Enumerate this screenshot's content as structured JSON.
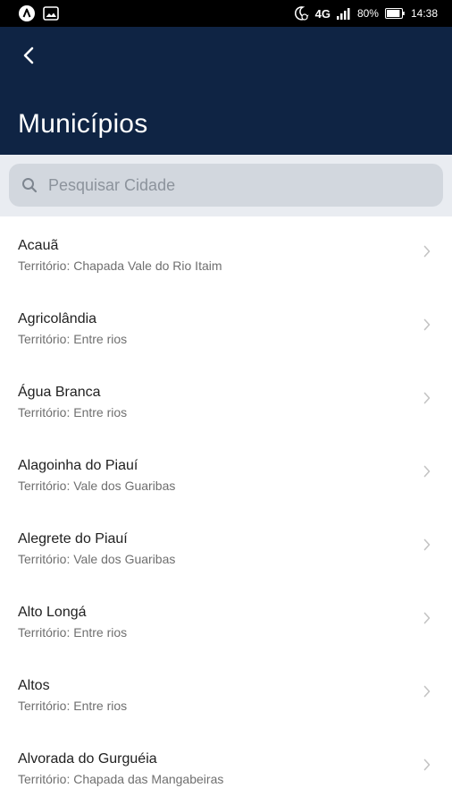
{
  "status_bar": {
    "network": "4G",
    "battery": "80%",
    "time": "14:38"
  },
  "header": {
    "title": "Municípios"
  },
  "search": {
    "placeholder": "Pesquisar Cidade",
    "value": ""
  },
  "cities": [
    {
      "name": "Acauã",
      "territory": "Território: Chapada Vale do Rio Itaim"
    },
    {
      "name": "Agricolândia",
      "territory": "Território: Entre rios"
    },
    {
      "name": "Água Branca",
      "territory": "Território: Entre rios"
    },
    {
      "name": "Alagoinha do Piauí",
      "territory": "Território: Vale dos Guaribas"
    },
    {
      "name": "Alegrete do Piauí",
      "territory": "Território: Vale dos Guaribas"
    },
    {
      "name": "Alto Longá",
      "territory": "Território: Entre rios"
    },
    {
      "name": "Altos",
      "territory": "Território: Entre rios"
    },
    {
      "name": "Alvorada do Gurguéia",
      "territory": "Território: Chapada das Mangabeiras"
    }
  ],
  "colors": {
    "header_bg": "#0f2444",
    "search_area_bg": "#e9ecf1",
    "search_box_bg": "#d2d7de"
  }
}
